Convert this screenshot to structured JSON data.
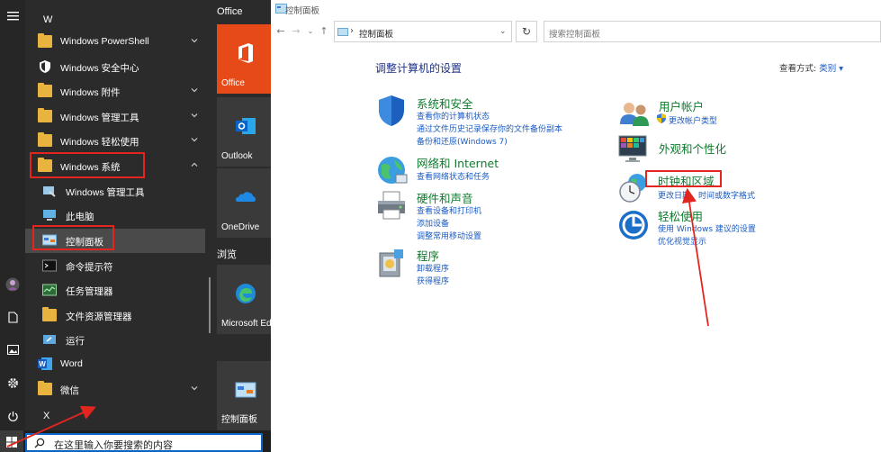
{
  "start_menu": {
    "letter_top": "W",
    "letter_bottom": "X",
    "apps": [
      {
        "label": "Windows PowerShell",
        "icon": "folder-icon",
        "expandable": true
      },
      {
        "label": "Windows 安全中心",
        "icon": "shield-icon",
        "expandable": false
      },
      {
        "label": "Windows 附件",
        "icon": "folder-icon",
        "expandable": true
      },
      {
        "label": "Windows 管理工具",
        "icon": "folder-icon",
        "expandable": true
      },
      {
        "label": "Windows 轻松使用",
        "icon": "folder-icon",
        "expandable": true
      },
      {
        "label": "Windows 系统",
        "icon": "folder-icon",
        "expandable": true,
        "expanded": true
      },
      {
        "label": "Windows 管理工具",
        "icon": "admin-tools-icon",
        "sub": true
      },
      {
        "label": "此电脑",
        "icon": "this-pc-icon",
        "sub": true
      },
      {
        "label": "控制面板",
        "icon": "control-panel-icon",
        "sub": true,
        "active": true
      },
      {
        "label": "命令提示符",
        "icon": "cmd-icon",
        "sub": true
      },
      {
        "label": "任务管理器",
        "icon": "task-manager-icon",
        "sub": true
      },
      {
        "label": "文件资源管理器",
        "icon": "file-explorer-icon",
        "sub": true
      },
      {
        "label": "运行",
        "icon": "run-icon",
        "sub": true
      },
      {
        "label": "Word",
        "icon": "word-icon"
      },
      {
        "label": "微信",
        "icon": "folder-icon",
        "expandable": true
      }
    ],
    "tiles": {
      "group_office": "Office",
      "office": "Office",
      "outlook": "Outlook",
      "onedrive": "OneDrive",
      "group_browse": "浏览",
      "edge": "Microsoft Edge",
      "control_panel": "控制面板"
    },
    "search_placeholder": "在这里输入你要搜索的内容"
  },
  "control_panel": {
    "window_title": "控制面板",
    "address": "控制面板",
    "search_placeholder": "搜索控制面板",
    "heading": "调整计算机的设置",
    "view_by_label": "查看方式:",
    "view_by_value": "类别",
    "categories": {
      "system_security": {
        "title": "系统和安全",
        "links": [
          "查看你的计算机状态",
          "通过文件历史记录保存你的文件备份副本",
          "备份和还原(Windows 7)"
        ]
      },
      "network": {
        "title": "网络和 Internet",
        "links": [
          "查看网络状态和任务"
        ]
      },
      "hardware": {
        "title": "硬件和声音",
        "links": [
          "查看设备和打印机",
          "添加设备",
          "调整常用移动设置"
        ]
      },
      "programs": {
        "title": "程序",
        "links": [
          "卸载程序",
          "获得程序"
        ]
      },
      "user_accounts": {
        "title": "用户帐户",
        "links": [
          "更改帐户类型"
        ]
      },
      "appearance": {
        "title": "外观和个性化",
        "links": []
      },
      "clock_region": {
        "title": "时钟和区域",
        "links": [
          "更改日期、时间或数字格式"
        ]
      },
      "ease_of_access": {
        "title": "轻松使用",
        "links": [
          "使用 Windows 建议的设置",
          "优化视觉显示"
        ]
      }
    }
  },
  "colors": {
    "accent_red": "#e2261f",
    "category_green": "#0e7b2d",
    "link_blue": "#1a5bc4",
    "heading_blue": "#1e3287",
    "start_bg": "#2b2b2b",
    "office_orange": "#e64a19"
  }
}
